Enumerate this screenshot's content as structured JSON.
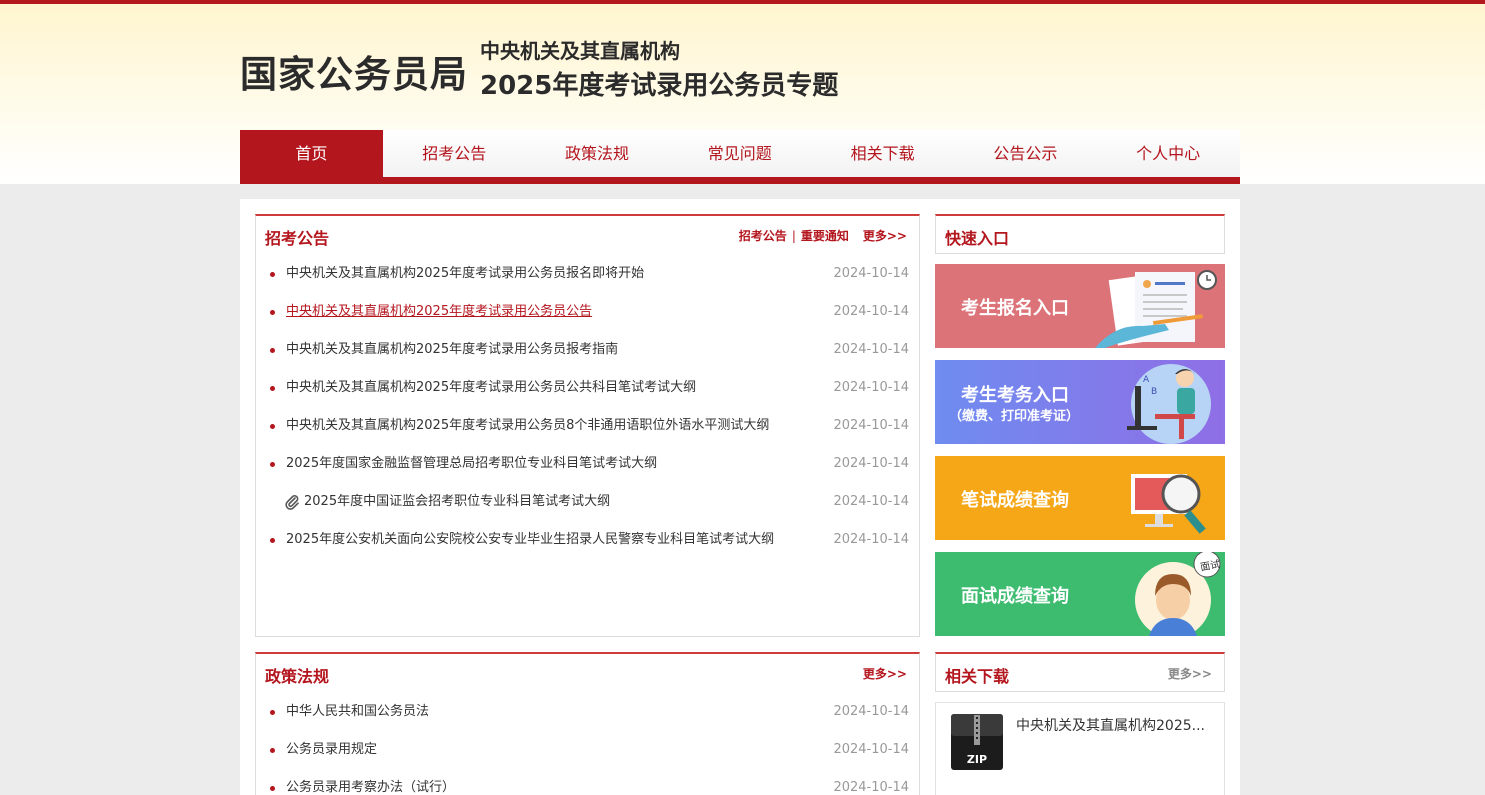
{
  "header": {
    "brand": "国家公务员局",
    "subtitle1": "中央机关及其直属机构",
    "subtitle2": "2025年度考试录用公务员专题"
  },
  "nav": {
    "items": [
      "首页",
      "招考公告",
      "政策法规",
      "常见问题",
      "相关下载",
      "公告公示",
      "个人中心"
    ],
    "active_index": 0
  },
  "announcements": {
    "title": "招考公告",
    "link1": "招考公告",
    "separator": "|",
    "link2": "重要通知",
    "more": "更多>>",
    "items": [
      {
        "text": "中央机关及其直属机构2025年度考试录用公务员报名即将开始",
        "date": "2024-10-14"
      },
      {
        "text": "中央机关及其直属机构2025年度考试录用公务员公告",
        "date": "2024-10-14"
      },
      {
        "text": "中央机关及其直属机构2025年度考试录用公务员报考指南",
        "date": "2024-10-14"
      },
      {
        "text": "中央机关及其直属机构2025年度考试录用公务员公共科目笔试考试大纲",
        "date": "2024-10-14"
      },
      {
        "text": "中央机关及其直属机构2025年度考试录用公务员8个非通用语职位外语水平测试大纲",
        "date": "2024-10-14"
      },
      {
        "text": "2025年度国家金融监督管理总局招考职位专业科目笔试考试大纲",
        "date": "2024-10-14"
      },
      {
        "text": "2025年度中国证监会招考职位专业科目笔试考试大纲",
        "date": "2024-10-14"
      },
      {
        "text": "2025年度公安机关面向公安院校公安专业毕业生招录人民警察专业科目笔试考试大纲",
        "date": "2024-10-14"
      }
    ]
  },
  "quick_entry": {
    "title": "快速入口",
    "banners": [
      {
        "label": "考生报名入口",
        "color": "#dc7378"
      },
      {
        "label": "考生考务入口",
        "sub": "（缴费、打印准考证）",
        "color": "#7a86ee"
      },
      {
        "label": "笔试成绩查询",
        "color": "#f6a717"
      },
      {
        "label": "面试成绩查询",
        "color": "#3dbc70",
        "badge": "面试"
      }
    ]
  },
  "policy": {
    "title": "政策法规",
    "more": "更多>>",
    "items": [
      {
        "text": "中华人民共和国公务员法",
        "date": "2024-10-14"
      },
      {
        "text": "公务员录用规定",
        "date": "2024-10-14"
      },
      {
        "text": "公务员录用考察办法（试行）",
        "date": "2024-10-14"
      }
    ]
  },
  "downloads": {
    "title": "相关下载",
    "more": "更多>>",
    "file_label": "中央机关及其直属机构2025...",
    "file_icon_text": "ZIP"
  }
}
